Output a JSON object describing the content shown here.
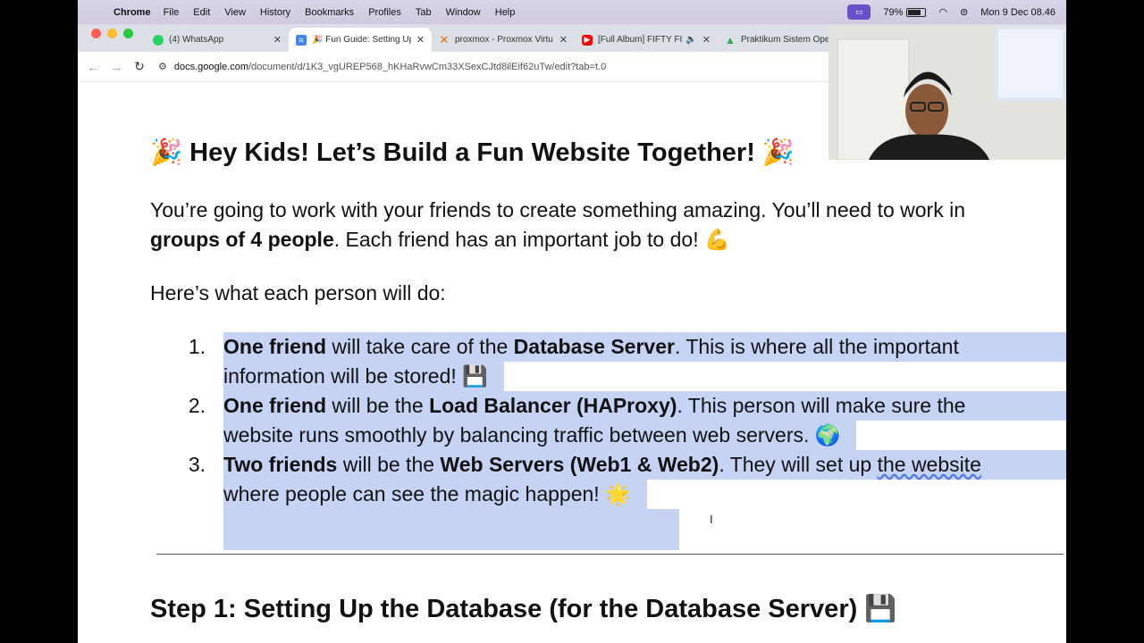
{
  "menubar": {
    "app": "Chrome",
    "items": [
      "File",
      "Edit",
      "View",
      "History",
      "Bookmarks",
      "Profiles",
      "Tab",
      "Window",
      "Help"
    ],
    "battery": "79%",
    "datetime": "Mon 9 Dec  08.46"
  },
  "tabs": [
    {
      "title": "(4) WhatsApp",
      "icon": "whatsapp-icon",
      "color": "#25d366"
    },
    {
      "title": "🎉 Fun Guide: Setting Up",
      "icon": "docs-icon",
      "color": "#4285f4"
    },
    {
      "title": "proxmox - Proxmox Virtu",
      "icon": "proxmox-icon",
      "color": "#e57000"
    },
    {
      "title": "[Full Album] FIFTY FI",
      "icon": "youtube-icon",
      "color": "#ff0000"
    },
    {
      "title": "Praktikum Sistem Opera",
      "icon": "drive-icon",
      "color": "#34a853"
    }
  ],
  "url": {
    "host": "docs.google.com",
    "path": "/document/d/1K3_vgUREP568_hKHaRvwCm33XSexCJtd8ilEif62uTw/edit?tab=t.0"
  },
  "doc": {
    "title": "🎉 Hey Kids! Let’s Build a Fun Website Together! 🎉",
    "intro_a": "You’re going to work with your friends to create something amazing. You’ll need to work in",
    "intro_bold": "groups of 4 people",
    "intro_b": ". Each friend has an important job to do! 💪",
    "list_intro": "Here’s what each person will do:",
    "items": [
      {
        "num": "1.",
        "b1": "One friend",
        "t1": " will take care of the ",
        "b2": "Database Server",
        "t2": ". This is where all the important",
        "line2": "information will be stored! 💾"
      },
      {
        "num": "2.",
        "b1": "One friend",
        "t1": " will be the ",
        "b2": "Load Balancer (HAProxy)",
        "t2": ". This person will make sure the",
        "line2": "website runs smoothly by balancing traffic between web servers. 🌍"
      },
      {
        "num": "3.",
        "b1": "Two friends",
        "t1": " will be the ",
        "b2": "Web Servers (Web1 & Web2)",
        "t2": ". They will set up ",
        "t2_underlined": "the website",
        "line2": "where people can see the magic happen! 🌟"
      }
    ],
    "step1": "Step 1: Setting Up the Database (for the Database Server) 💾"
  }
}
